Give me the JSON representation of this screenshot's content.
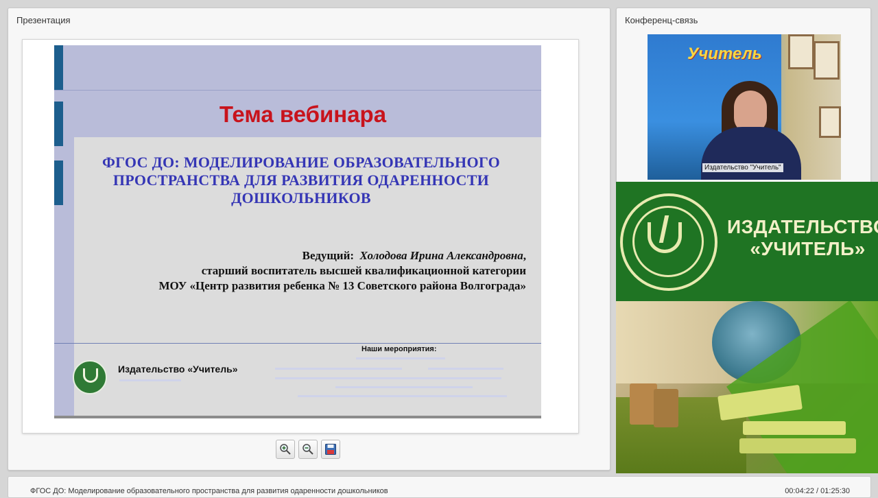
{
  "presentation_panel": {
    "title": "Презентация"
  },
  "conference_panel": {
    "title": "Конференц-связь",
    "video_caption": "Издательство \"Учитель\"",
    "banner_brand": "Учитель"
  },
  "slide": {
    "title": "Тема вебинара",
    "subtitle": "ФГОС ДО: МОДЕЛИРОВАНИЕ ОБРАЗОВАТЕЛЬНОГО ПРОСТРАНСТВА ДЛЯ РАЗВИТИЯ ОДАРЕННОСТИ ДОШКОЛЬНИКОВ",
    "presenter_label": "Ведущий:",
    "presenter_name": "Холодова Ирина Александровна",
    "presenter_role": "старший воспитатель высшей квалификационной категории",
    "presenter_org": "МОУ «Центр развития ребенка № 13 Советского района Волгограда»",
    "publisher": "Издательство «Учитель»",
    "events_label": "Наши мероприятия:"
  },
  "toolbar": {
    "zoom_in": "zoom-in",
    "zoom_out": "zoom-out",
    "save": "save"
  },
  "promo": {
    "line1": "ИЗДАТЕЛЬСТВО",
    "line2": "«УЧИТЕЛЬ»"
  },
  "status": {
    "webinar_title": "ФГОС ДО: Моделирование образовательного пространства для развития одаренности дошкольников",
    "time": "00:04:22 / 01:25:30"
  },
  "colors": {
    "slide_title": "#c8131c",
    "slide_subtitle": "#3536b5",
    "promo_green": "#1f7423",
    "accent_blue": "#1c5e8d"
  }
}
